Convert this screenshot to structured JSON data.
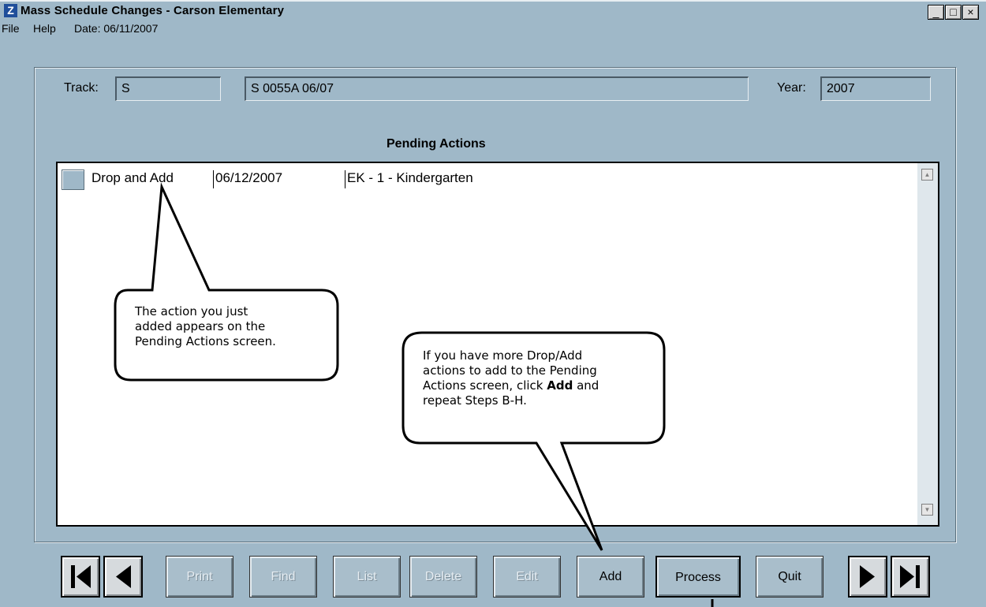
{
  "window": {
    "title": "Mass Schedule Changes - Carson Elementary",
    "app_icon_letter": "Z",
    "minimize_glyph": "_",
    "maximize_glyph": "□",
    "close_glyph": "×"
  },
  "menu": {
    "file": "File",
    "help": "Help",
    "date": "Date: 06/11/2007"
  },
  "header": {
    "track_label": "Track:",
    "track_value": "S",
    "schedule_value": "S 0055A 06/07",
    "year_label": "Year:",
    "year_value": "2007"
  },
  "pending": {
    "title": "Pending Actions",
    "rows": [
      {
        "action": "Drop and Add",
        "date": "06/12/2007",
        "detail": "EK - 1 - Kindergarten"
      }
    ]
  },
  "callouts": {
    "first_line1": "The action you just",
    "first_line2": "added appears on the",
    "first_line3": "Pending Actions screen.",
    "second_line1": "If you have more Drop/Add",
    "second_line2": "actions to add to the Pending",
    "second_line3_a": "Actions screen, click ",
    "second_line3_b": "Add",
    "second_line3_c": " and",
    "second_line4": "repeat Steps B-H."
  },
  "buttons": {
    "print": "Print",
    "find": "Find",
    "list": "List",
    "delete": "Delete",
    "edit": "Edit",
    "add": "Add",
    "process": "Process",
    "quit": "Quit"
  },
  "icons": {
    "first": "first-record-icon",
    "prev": "previous-record-icon",
    "next": "next-record-icon",
    "last": "last-record-icon"
  }
}
